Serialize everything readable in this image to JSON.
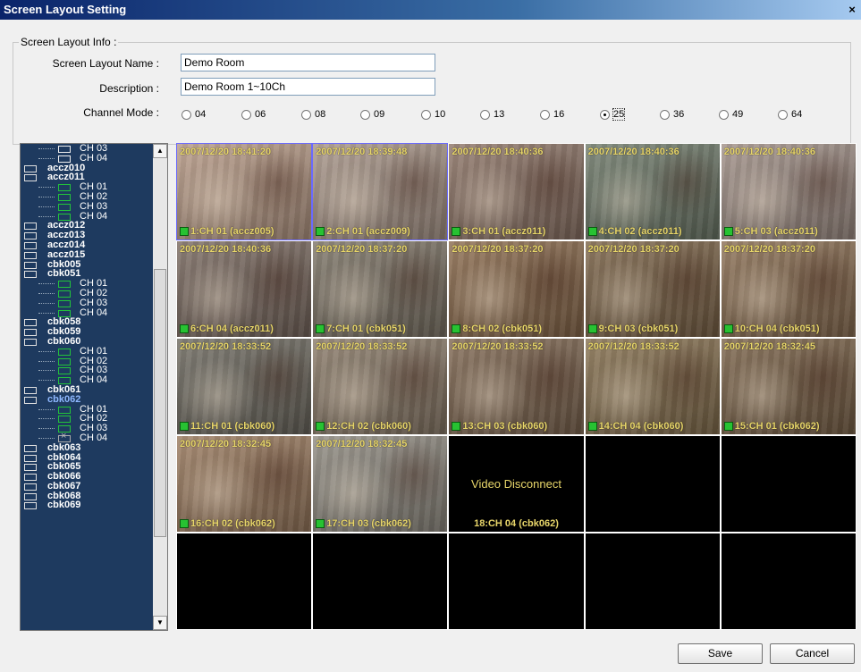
{
  "window": {
    "title": "Screen Layout Setting",
    "close_glyph": "×"
  },
  "info": {
    "legend": "Screen Layout Info :",
    "name_label": "Screen Layout Name :",
    "name_value": "Demo Room",
    "desc_label": "Description :",
    "desc_value": "Demo Room 1~10Ch",
    "mode_label": "Channel Mode :",
    "modes": [
      "04",
      "06",
      "08",
      "09",
      "10",
      "13",
      "16",
      "25",
      "36",
      "49",
      "64"
    ],
    "selected_mode": "25"
  },
  "tree": {
    "items": [
      {
        "type": "ch",
        "label": "CH 03",
        "icon": "dark"
      },
      {
        "type": "ch",
        "label": "CH 04",
        "icon": "dark"
      },
      {
        "type": "node",
        "label": "accz010"
      },
      {
        "type": "node",
        "label": "accz011"
      },
      {
        "type": "ch",
        "label": "CH 01",
        "icon": "green"
      },
      {
        "type": "ch",
        "label": "CH 02",
        "icon": "green"
      },
      {
        "type": "ch",
        "label": "CH 03",
        "icon": "green"
      },
      {
        "type": "ch",
        "label": "CH 04",
        "icon": "green"
      },
      {
        "type": "node",
        "label": "accz012"
      },
      {
        "type": "node",
        "label": "accz013"
      },
      {
        "type": "node",
        "label": "accz014"
      },
      {
        "type": "node",
        "label": "accz015"
      },
      {
        "type": "node",
        "label": "cbk005"
      },
      {
        "type": "node",
        "label": "cbk051"
      },
      {
        "type": "ch",
        "label": "CH 01",
        "icon": "green"
      },
      {
        "type": "ch",
        "label": "CH 02",
        "icon": "green"
      },
      {
        "type": "ch",
        "label": "CH 03",
        "icon": "green"
      },
      {
        "type": "ch",
        "label": "CH 04",
        "icon": "green"
      },
      {
        "type": "node",
        "label": "cbk058"
      },
      {
        "type": "node",
        "label": "cbk059"
      },
      {
        "type": "node",
        "label": "cbk060"
      },
      {
        "type": "ch",
        "label": "CH 01",
        "icon": "green"
      },
      {
        "type": "ch",
        "label": "CH 02",
        "icon": "green"
      },
      {
        "type": "ch",
        "label": "CH 03",
        "icon": "green"
      },
      {
        "type": "ch",
        "label": "CH 04",
        "icon": "green"
      },
      {
        "type": "node",
        "label": "cbk061"
      },
      {
        "type": "node",
        "label": "cbk062",
        "selected": true
      },
      {
        "type": "ch",
        "label": "CH 01",
        "icon": "green"
      },
      {
        "type": "ch",
        "label": "CH 02",
        "icon": "green"
      },
      {
        "type": "ch",
        "label": "CH 03",
        "icon": "green"
      },
      {
        "type": "ch",
        "label": "CH 04",
        "icon": "off"
      },
      {
        "type": "node",
        "label": "cbk063"
      },
      {
        "type": "node",
        "label": "cbk064"
      },
      {
        "type": "node",
        "label": "cbk065"
      },
      {
        "type": "node",
        "label": "cbk066"
      },
      {
        "type": "node",
        "label": "cbk067"
      },
      {
        "type": "node",
        "label": "cbk068"
      },
      {
        "type": "node",
        "label": "cbk069"
      }
    ],
    "scroll_up": "▲",
    "scroll_down": "▼"
  },
  "cells": [
    {
      "kind": "cam",
      "ts": "2007/12/20 18:41:20",
      "label": "1:CH 01 (accz005)",
      "color": "#b79a86",
      "selected": true
    },
    {
      "kind": "cam",
      "ts": "2007/12/20 18:39:48",
      "label": "2:CH 01 (accz009)",
      "color": "#a89588",
      "selected": true
    },
    {
      "kind": "cam",
      "ts": "2007/12/20 18:40:36",
      "label": "3:CH 01 (accz011)",
      "color": "#8d7466"
    },
    {
      "kind": "cam",
      "ts": "2007/12/20 18:40:36",
      "label": "4:CH 02 (accz011)",
      "color": "#6f7a6a"
    },
    {
      "kind": "cam",
      "ts": "2007/12/20 18:40:36",
      "label": "5:CH 03 (accz011)",
      "color": "#a08f86"
    },
    {
      "kind": "cam",
      "ts": "2007/12/20 18:40:36",
      "label": "6:CH 04 (accz011)",
      "color": "#7a6a60"
    },
    {
      "kind": "cam",
      "ts": "2007/12/20 18:37:20",
      "label": "7:CH 01 (cbk051)",
      "color": "#7d7466"
    },
    {
      "kind": "cam",
      "ts": "2007/12/20 18:37:20",
      "label": "8:CH 02 (cbk051)",
      "color": "#8a6a4c"
    },
    {
      "kind": "cam",
      "ts": "2007/12/20 18:37:20",
      "label": "9:CH 03 (cbk051)",
      "color": "#7c6448"
    },
    {
      "kind": "cam",
      "ts": "2007/12/20 18:37:20",
      "label": "10:CH 04 (cbk051)",
      "color": "#8a6e52"
    },
    {
      "kind": "cam",
      "ts": "2007/12/20 18:33:52",
      "label": "11:CH 01 (cbk060)",
      "color": "#6e6a60"
    },
    {
      "kind": "cam",
      "ts": "2007/12/20 18:33:52",
      "label": "12:CH 02 (cbk060)",
      "color": "#8a7a68"
    },
    {
      "kind": "cam",
      "ts": "2007/12/20 18:33:52",
      "label": "13:CH 03 (cbk060)",
      "color": "#7e6650"
    },
    {
      "kind": "cam",
      "ts": "2007/12/20 18:33:52",
      "label": "14:CH 04 (cbk060)",
      "color": "#86704f"
    },
    {
      "kind": "cam",
      "ts": "2007/12/20 18:32:45",
      "label": "15:CH 01 (cbk062)",
      "color": "#7a6248"
    },
    {
      "kind": "cam",
      "ts": "2007/12/20 18:32:45",
      "label": "16:CH 02 (cbk062)",
      "color": "#9a7a5e"
    },
    {
      "kind": "cam",
      "ts": "2007/12/20 18:32:45",
      "label": "17:CH 03 (cbk062)",
      "color": "#8f8a80"
    },
    {
      "kind": "disc",
      "message": "Video Disconnect",
      "label": "18:CH 04 (cbk062)"
    },
    {
      "kind": "empty"
    },
    {
      "kind": "empty"
    },
    {
      "kind": "empty"
    },
    {
      "kind": "empty"
    },
    {
      "kind": "empty"
    },
    {
      "kind": "empty"
    },
    {
      "kind": "empty"
    }
  ],
  "buttons": {
    "save": "Save",
    "cancel": "Cancel"
  }
}
